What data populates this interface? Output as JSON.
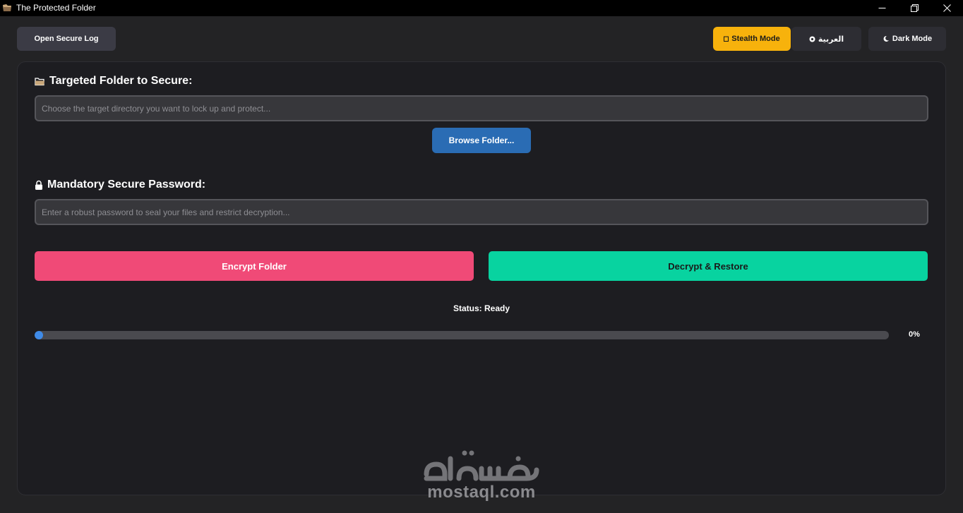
{
  "window": {
    "title": "The Protected Folder"
  },
  "toolbar": {
    "log_label": "Open Secure Log",
    "stealth_label": "Stealth Mode",
    "arabic_label": "العربية",
    "dark_label": "Dark Mode"
  },
  "folder": {
    "label": "Targeted Folder to Secure:",
    "placeholder": "Choose the target directory you want to lock up and protect...",
    "browse_label": "Browse Folder..."
  },
  "password": {
    "label": "Mandatory Secure Password:",
    "placeholder": "Enter a robust password to seal your files and restrict decryption..."
  },
  "actions": {
    "encrypt_label": "Encrypt Folder",
    "decrypt_label": "Decrypt & Restore"
  },
  "status": {
    "text": "Status: Ready"
  },
  "progress": {
    "value": 0,
    "label": "0%"
  },
  "watermark": {
    "latin": "mostaql.com"
  },
  "colors": {
    "stealth": "#f7b20c",
    "encrypt": "#f04a77",
    "decrypt": "#08d3a0",
    "browse": "#2a6cb4",
    "progress": "#3f8be8"
  }
}
